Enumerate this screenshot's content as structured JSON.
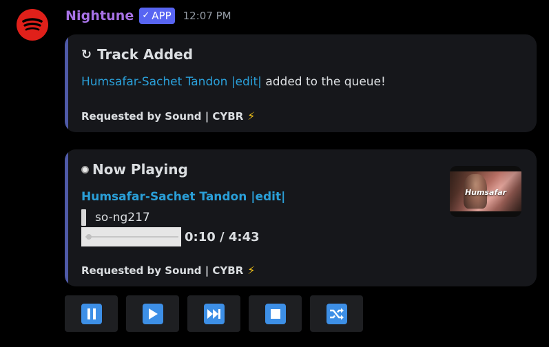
{
  "message": {
    "username": "Nightune",
    "badge": "APP",
    "badge_check": "✓",
    "timestamp": "12:07 PM",
    "avatar_icon": "spotify-icon"
  },
  "embeds": [
    {
      "title_icon": "↻",
      "title": "Track Added",
      "track_link": "Humsafar-Sachet Tandon |edit|",
      "desc_suffix": " added to the queue!",
      "footer": "Requested by Sound | CYBR",
      "footer_icon": "⚡"
    },
    {
      "title_icon": "record-icon",
      "title": "Now Playing",
      "track_link": "Humsafar-Sachet Tandon |edit|",
      "quote": "so-ng217",
      "progress_time": "0:10 / 4:43",
      "progress_fraction": 0.035,
      "thumbnail_text": "Humsafar",
      "footer": "Requested by Sound | CYBR",
      "footer_icon": "⚡"
    }
  ],
  "buttons": [
    {
      "icon": "pause-icon"
    },
    {
      "icon": "play-icon"
    },
    {
      "icon": "skip-icon"
    },
    {
      "icon": "stop-icon"
    },
    {
      "icon": "shuffle-icon"
    }
  ],
  "colors": {
    "username": "#a772e6",
    "badge": "#5865f2",
    "link": "#2a9fd8",
    "embed_accent": "#4f5aa8",
    "button_icon": "#3d8fe6",
    "avatar": "#e0201a"
  }
}
